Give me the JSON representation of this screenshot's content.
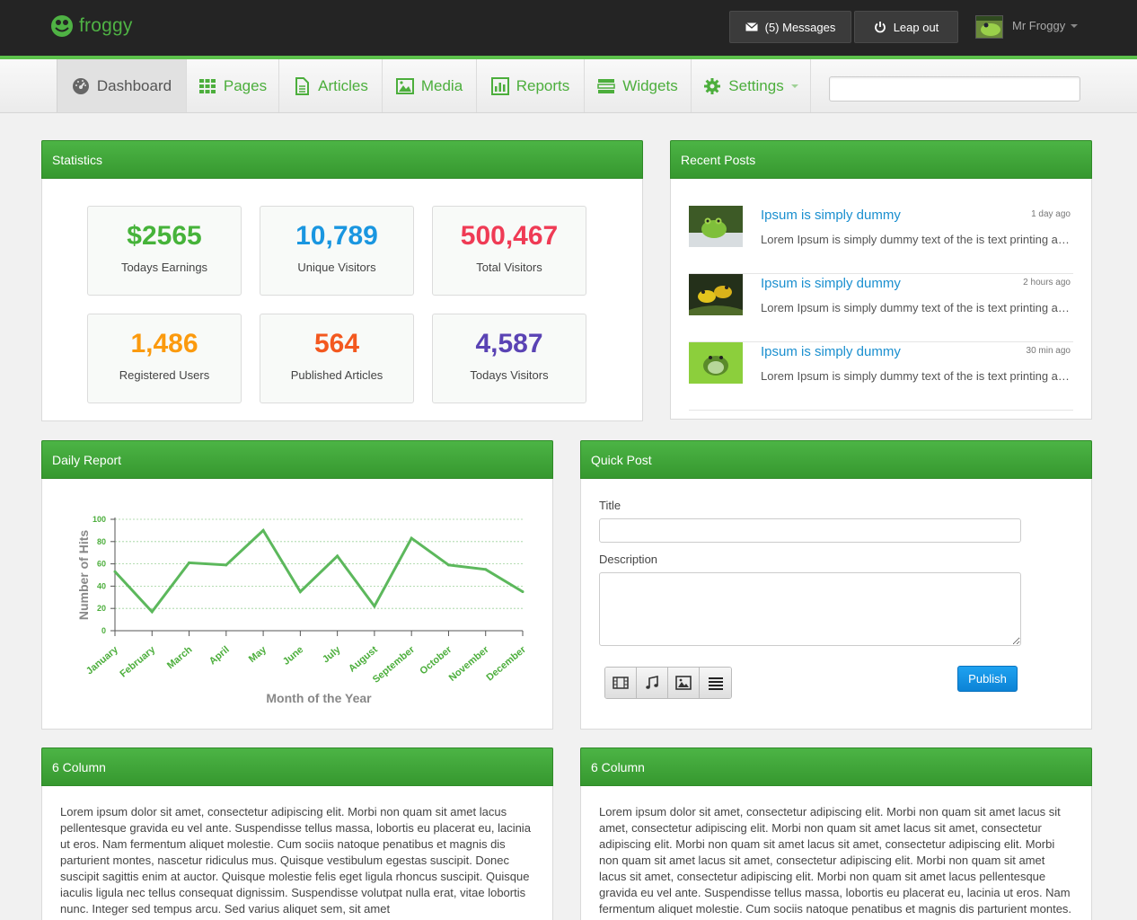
{
  "brand": {
    "name": "froggy"
  },
  "topbar": {
    "messages_label": "(5) Messages",
    "leap_label": "Leap out",
    "user_name": "Mr Froggy"
  },
  "nav": {
    "items": [
      {
        "label": "Dashboard",
        "icon": "dashboard-icon"
      },
      {
        "label": "Pages",
        "icon": "grid-icon"
      },
      {
        "label": "Articles",
        "icon": "document-icon"
      },
      {
        "label": "Media",
        "icon": "image-icon"
      },
      {
        "label": "Reports",
        "icon": "bar-chart-icon"
      },
      {
        "label": "Widgets",
        "icon": "widgets-icon"
      },
      {
        "label": "Settings",
        "icon": "gear-icon"
      }
    ],
    "search_placeholder": ""
  },
  "statistics": {
    "title": "Statistics",
    "items": [
      {
        "value": "$2565",
        "label": "Todays Earnings",
        "color": "#46b33a"
      },
      {
        "value": "10,789",
        "label": "Unique Visitors",
        "color": "#1a96e0"
      },
      {
        "value": "500,467",
        "label": "Total Visitors",
        "color": "#ef3b55"
      },
      {
        "value": "1,486",
        "label": "Registered Users",
        "color": "#fb9a0e"
      },
      {
        "value": "564",
        "label": "Published Articles",
        "color": "#f3581f"
      },
      {
        "value": "4,587",
        "label": "Todays Visitors",
        "color": "#5a43b4"
      }
    ]
  },
  "recent_posts": {
    "title": "Recent Posts",
    "items": [
      {
        "title": "Ipsum is simply dummy",
        "time": "1 day ago",
        "text": "Lorem Ipsum is simply dummy text of the is text printing and typesetting"
      },
      {
        "title": "Ipsum is simply dummy",
        "time": "2 hours ago",
        "text": "Lorem Ipsum is simply dummy text of the is text printing and typesetting"
      },
      {
        "title": "Ipsum is simply dummy",
        "time": "30 min ago",
        "text": "Lorem Ipsum is simply dummy text of the is text printing and typesetting"
      }
    ]
  },
  "daily_report": {
    "title": "Daily Report"
  },
  "chart_data": {
    "type": "line",
    "categories": [
      "January",
      "February",
      "March",
      "April",
      "May",
      "June",
      "July",
      "August",
      "September",
      "October",
      "November",
      "December"
    ],
    "series": [
      {
        "values": [
          53,
          17,
          61,
          59,
          90,
          35,
          67,
          22,
          83,
          59,
          55,
          35
        ]
      }
    ],
    "xlabel": "Month of the Year",
    "ylabel": "Number of Hits",
    "ylim": [
      0,
      100
    ],
    "yticks": [
      0,
      20,
      40,
      60,
      80,
      100
    ],
    "grid": true,
    "color": "#5cb85c"
  },
  "quick_post": {
    "title": "Quick Post",
    "title_label": "Title",
    "description_label": "Description",
    "publish_label": "Publish"
  },
  "columns": [
    {
      "title": "6 Column",
      "text": "Lorem ipsum dolor sit amet, consectetur adipiscing elit. Morbi non quam sit amet lacus pellentesque gravida eu vel ante. Suspendisse tellus massa, lobortis eu placerat eu, lacinia ut eros. Nam fermentum aliquet molestie. Cum sociis natoque penatibus et magnis dis parturient montes, nascetur ridiculus mus. Quisque vestibulum egestas suscipit. Donec suscipit sagittis enim at auctor. Quisque molestie felis eget ligula rhoncus suscipit. Quisque iaculis ligula nec tellus consequat dignissim. Suspendisse volutpat nulla erat, vitae lobortis nunc. Integer sed tempus arcu. Sed varius aliquet sem, sit amet"
    },
    {
      "title": "6 Column",
      "text": "Lorem ipsum dolor sit amet, consectetur adipiscing elit. Morbi non quam sit amet lacus sit amet, consectetur adipiscing elit. Morbi non quam sit amet lacus sit amet, consectetur adipiscing elit. Morbi non quam sit amet lacus sit amet, consectetur adipiscing elit. Morbi non quam sit amet lacus sit amet, consectetur adipiscing elit. Morbi non quam sit amet lacus sit amet, consectetur adipiscing elit. Morbi non quam sit amet lacus pellentesque gravida eu vel ante. Suspendisse tellus massa, lobortis eu placerat eu, lacinia ut eros. Nam fermentum aliquet molestie. Cum sociis natoque penatibus et magnis dis parturient montes. Morbi"
    }
  ]
}
